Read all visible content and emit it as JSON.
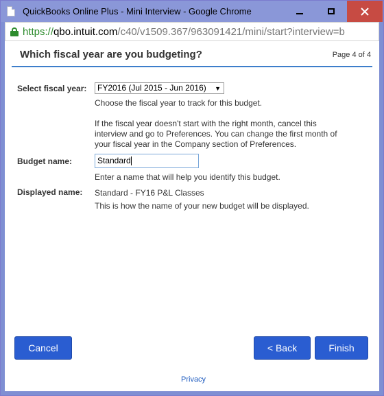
{
  "window": {
    "title": "QuickBooks Online Plus - Mini Interview - Google Chrome",
    "url_scheme": "https://",
    "url_host": "qbo.intuit.com",
    "url_path": "/c40/v1509.367/963091421/mini/start?interview=b"
  },
  "header": {
    "title": "Which fiscal year are you budgeting?",
    "page_count": "Page 4 of 4"
  },
  "fiscal_year": {
    "label": "Select fiscal year:",
    "selected": "FY2016 (Jul 2015 - Jun 2016)",
    "help": "Choose the fiscal year to track for this budget.",
    "note_line1": "If the fiscal year doesn't start with the right month, cancel this",
    "note_line2": "interview and go to Preferences. You can change the first month of",
    "note_line3": "your fiscal year in the Company section of Preferences."
  },
  "budget_name": {
    "label": "Budget name:",
    "value": "Standard",
    "help": "Enter a name that will help you identify this budget."
  },
  "displayed_name": {
    "label": "Displayed name:",
    "value": "Standard - FY16 P&L Classes",
    "help": "This is how the name of your new budget will be displayed."
  },
  "buttons": {
    "cancel": "Cancel",
    "back": "< Back",
    "finish": "Finish"
  },
  "footer": {
    "privacy": "Privacy"
  },
  "colors": {
    "accent": "#2a5dd1",
    "titlebar": "#8a97d8",
    "close": "#c74b43"
  }
}
